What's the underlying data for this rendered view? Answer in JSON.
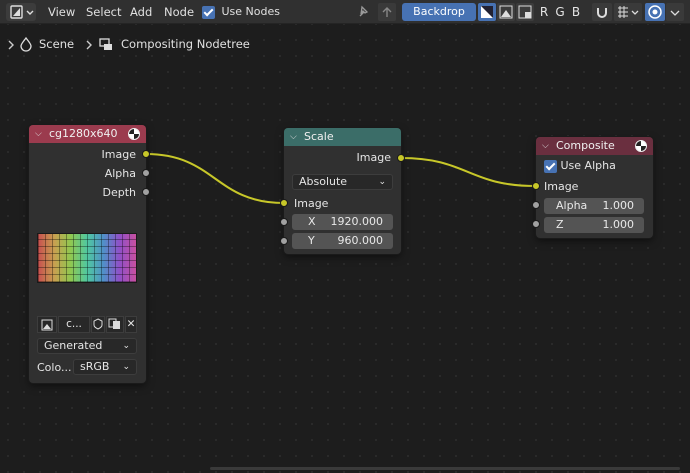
{
  "header": {
    "menus": [
      "View",
      "Select",
      "Add",
      "Node"
    ],
    "use_nodes_label": "Use Nodes",
    "backdrop_label": "Backdrop",
    "channel_r": "R",
    "channel_g": "G",
    "channel_b": "B"
  },
  "breadcrumb": {
    "scene": "Scene",
    "tree": "Compositing Nodetree"
  },
  "nodes": {
    "image": {
      "title": "cg1280x640",
      "outputs": [
        "Image",
        "Alpha",
        "Depth"
      ],
      "image_name_short": "c...",
      "source": "Generated",
      "colorspace_label": "Colo...",
      "colorspace_value": "sRGB",
      "header_color": "#9b3b4e"
    },
    "scale": {
      "title": "Scale",
      "output": "Image",
      "mode": "Absolute",
      "input": "Image",
      "x_label": "X",
      "x_value": "1920.000",
      "y_label": "Y",
      "y_value": "960.000",
      "header_color": "#3b6d68"
    },
    "composite": {
      "title": "Composite",
      "use_alpha_label": "Use Alpha",
      "input": "Image",
      "alpha_label": "Alpha",
      "alpha_value": "1.000",
      "z_label": "Z",
      "z_value": "1.000",
      "header_color": "#6a2f3f"
    }
  },
  "colors": {
    "socket_color": "#c7c729",
    "link_color": "#c7c729",
    "accent": "#4772b3"
  }
}
